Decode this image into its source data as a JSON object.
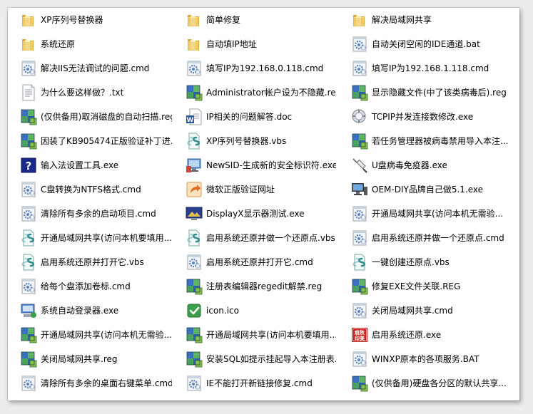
{
  "colors": {
    "folder": "#e8c35a",
    "gear_blue": "#3a6fc2",
    "puzzle_green": "#3aa04a",
    "script_teal": "#2f8c8c"
  },
  "items": [
    {
      "label": "XP序列号替换器",
      "icon": "folder-icon"
    },
    {
      "label": "简单修复",
      "icon": "folder-icon"
    },
    {
      "label": "解决局域网共享",
      "icon": "folder-icon"
    },
    {
      "label": "系统还原",
      "icon": "folder-icon"
    },
    {
      "label": "自动填IP地址",
      "icon": "folder-icon"
    },
    {
      "label": "自动关闭空闲的IDE通道.bat",
      "icon": "batch-gear-icon"
    },
    {
      "label": "解决IIS无法调试的问题.cmd",
      "icon": "batch-gear-icon"
    },
    {
      "label": "填写IP为192.168.0.118.cmd",
      "icon": "batch-gear-icon"
    },
    {
      "label": "填写IP为192.168.1.118.cmd",
      "icon": "batch-gear-icon"
    },
    {
      "label": "为什么要这样做？.txt",
      "icon": "text-file-icon"
    },
    {
      "label": "Administrator帐户设为不隐藏.reg",
      "icon": "registry-icon"
    },
    {
      "label": "显示隐藏文件(中了该类病毒后).reg",
      "icon": "registry-icon"
    },
    {
      "label": "(仅供备用)取消磁盘的自动扫描.reg",
      "icon": "registry-icon"
    },
    {
      "label": "IP相关的问题解答.doc",
      "icon": "word-doc-icon"
    },
    {
      "label": "TCPIP并发连接数修改.exe",
      "icon": "tcpip-tool-icon"
    },
    {
      "label": "因装了KB905474正版验证补丁进...",
      "icon": "registry-icon"
    },
    {
      "label": "XP序列号替换器.vbs",
      "icon": "vbscript-icon"
    },
    {
      "label": "若任务管理器被病毒禁用导入本注...",
      "icon": "registry-icon"
    },
    {
      "label": "输入法设置工具.exe",
      "icon": "help-exe-icon"
    },
    {
      "label": "NewSID-生成新的安全标识符.exe",
      "icon": "newsid-icon"
    },
    {
      "label": "U盘病毒免疫器.exe",
      "icon": "syringe-icon"
    },
    {
      "label": "C盘转换为NTFS格式.cmd",
      "icon": "batch-gear-icon"
    },
    {
      "label": "微软正版验证网址",
      "icon": "shortcut-icon"
    },
    {
      "label": "OEM-DIY品牌自己做5.1.exe",
      "icon": "computer-icon"
    },
    {
      "label": "清除所有多余的启动项目.cmd",
      "icon": "batch-gear-icon"
    },
    {
      "label": "DisplayX显示器测试.exe",
      "icon": "display-test-icon"
    },
    {
      "label": "开通局域网共享(访问本机无需验...",
      "icon": "batch-gear-icon"
    },
    {
      "label": "开通局域网共享(访问本机要填用...",
      "icon": "vbscript-icon"
    },
    {
      "label": "启用系统还原并做一个还原点.vbs",
      "icon": "vbscript-icon"
    },
    {
      "label": "启用系统还原并做一个还原点.cmd",
      "icon": "batch-gear-icon"
    },
    {
      "label": "启用系统还原并打开它.vbs",
      "icon": "vbscript-icon"
    },
    {
      "label": "启用系统还原并打开它.cmd",
      "icon": "batch-gear-icon"
    },
    {
      "label": "一键创建还原点.vbs",
      "icon": "vbscript-icon"
    },
    {
      "label": "给每个盘添加卷标.cmd",
      "icon": "batch-gear-icon"
    },
    {
      "label": "注册表编辑器regedit解禁.reg",
      "icon": "registry-icon"
    },
    {
      "label": "修复EXE文件关联.REG",
      "icon": "registry-icon"
    },
    {
      "label": "系统自动登录器.exe",
      "icon": "auto-login-icon"
    },
    {
      "label": "icon.ico",
      "icon": "check-ico-icon"
    },
    {
      "label": "关闭局域网共享.cmd",
      "icon": "batch-gear-icon"
    },
    {
      "label": "开通局域网共享(访问本机无需验...",
      "icon": "registry-icon"
    },
    {
      "label": "开通局域网共享(访问本机要填用...",
      "icon": "registry-icon"
    },
    {
      "label": "启用系统还原.exe",
      "icon": "seal-stamp-icon",
      "stamp_text": "痕秋印美"
    },
    {
      "label": "关闭局域网共享.reg",
      "icon": "registry-icon"
    },
    {
      "label": "安装SQL如提示挂起导入本注册表...",
      "icon": "registry-icon"
    },
    {
      "label": "WINXP原本的各项服务.BAT",
      "icon": "batch-gear-icon"
    },
    {
      "label": "清除所有多余的桌面右键菜单.cmd",
      "icon": "batch-gear-icon"
    },
    {
      "label": "IE不能打开新链接修复.cmd",
      "icon": "batch-gear-icon"
    },
    {
      "label": "(仅供备用)硬盘各分区的默认共享...",
      "icon": "registry-icon"
    }
  ]
}
